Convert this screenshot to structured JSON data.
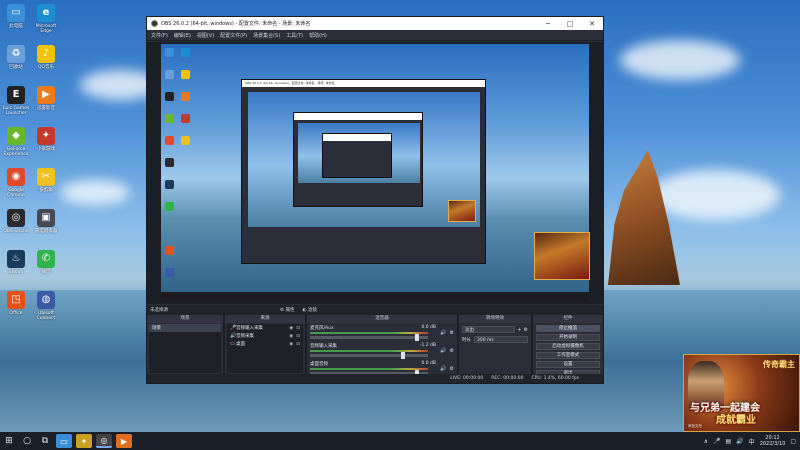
{
  "obs": {
    "title": "OBS 26.0.2 (64-bit, windows) - 配置文件: 未命名 - 场景: 未命名",
    "menu": [
      "文件(F)",
      "编辑(E)",
      "视图(V)",
      "配置文件(P)",
      "场景集合(S)",
      "工具(T)",
      "帮助(H)"
    ],
    "nested_title": "OBS 26.0.2 (64-bit, windows) - 配置文件: 未命名 - 场景: 未命名",
    "dockbar": {
      "label": "未选择源",
      "props": "属性",
      "filters": "滤镜"
    },
    "scenes": {
      "header": "场景",
      "items": [
        "场景"
      ]
    },
    "sources": {
      "header": "来源",
      "items": [
        {
          "icon": "🎤",
          "label": "音频输入采集"
        },
        {
          "icon": "🔊",
          "label": "音频采集"
        },
        {
          "icon": "▭",
          "label": "桌面"
        }
      ]
    },
    "mixer": {
      "header": "混音器",
      "channels": [
        {
          "name": "麦克风/Aux",
          "db": "0.0 dB",
          "level": 0.92
        },
        {
          "name": "音频输入采集",
          "db": "-1.2 dB",
          "level": 0.8
        },
        {
          "name": "桌面音频",
          "db": "0.0 dB",
          "level": 0.92
        }
      ]
    },
    "transitions": {
      "header": "转场特效",
      "type": "淡出",
      "duration_label": "时长",
      "duration": "300 ms"
    },
    "controls": {
      "header": "控件",
      "buttons": [
        "停止推流",
        "开始录制",
        "启动虚拟摄像机",
        "工作室模式",
        "设置",
        "退出"
      ]
    },
    "status": {
      "live": "LIVE: 00:00:00",
      "rec": "REC: 00:00:00",
      "cpu": "CPU: 1.4%, 60.00 fps"
    }
  },
  "desktop_icons": [
    {
      "label": "此电脑",
      "color": "#3b8fd8",
      "glyph": "▭"
    },
    {
      "label": "Microsoft Edge",
      "color": "#1c8fd4",
      "glyph": "e"
    },
    {
      "label": "回收站",
      "color": "#6aa0d8",
      "glyph": "♻"
    },
    {
      "label": "QQ音乐",
      "color": "#f2c200",
      "glyph": "♪"
    },
    {
      "label": "Epic Games Launcher",
      "color": "#222222",
      "glyph": "E"
    },
    {
      "label": "迅雷影音",
      "color": "#f07a1a",
      "glyph": "▶"
    },
    {
      "label": "GeForce Experience",
      "color": "#6ab82a",
      "glyph": "◆"
    },
    {
      "label": "小菊游戏",
      "color": "#c23a2a",
      "glyph": "✦"
    },
    {
      "label": "Google Chrome",
      "color": "#e04a2a",
      "glyph": "◉"
    },
    {
      "label": "快剪辑",
      "color": "#f0c020",
      "glyph": "✂"
    },
    {
      "label": "OBS Studio",
      "color": "#2a2a30",
      "glyph": "◎"
    },
    {
      "label": "雷电模拟器",
      "color": "#444a55",
      "glyph": "▣"
    },
    {
      "label": "Steam",
      "color": "#1a3a5a",
      "glyph": "♨"
    },
    {
      "label": "微信",
      "color": "#2fb44a",
      "glyph": "✆"
    },
    {
      "label": "Office",
      "color": "#e8501a",
      "glyph": "◳"
    },
    {
      "label": "Ubisoft Connect",
      "color": "#3a5aa8",
      "glyph": "◍"
    }
  ],
  "ad": {
    "brand": "传奇霸主",
    "slogan1": "与兄弟一起建会",
    "slogan2": "成就霸业",
    "license": "审批文号"
  },
  "taskbar": {
    "time": "20:12",
    "date": "2022/3/10"
  }
}
